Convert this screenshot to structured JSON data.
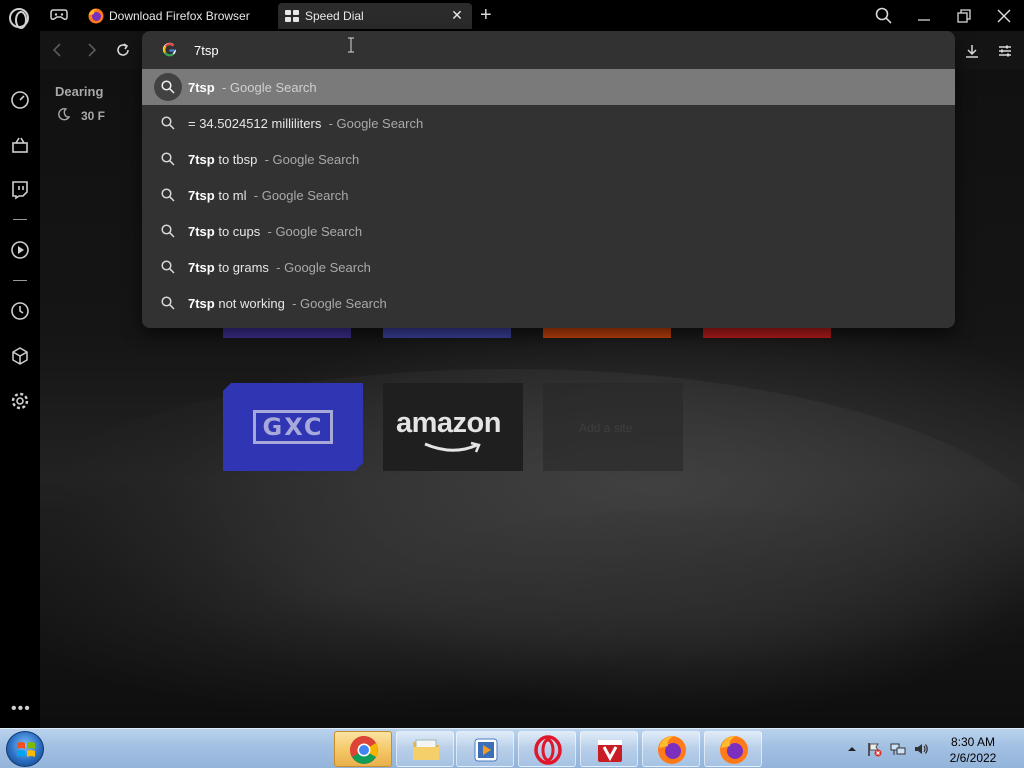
{
  "window": {
    "tabs": [
      {
        "title": "Download Firefox Browser",
        "icon": "firefox-icon"
      },
      {
        "title": "Speed Dial",
        "icon": "speed-dial-grid-icon",
        "active": true
      }
    ],
    "new_tab_symbol": "+",
    "close_symbol": "✕"
  },
  "sidebar": {
    "items": [
      "speedometer-icon",
      "shopping-bag-icon",
      "twitch-icon",
      "player-icon",
      "history-icon",
      "extensions-cube-icon",
      "settings-gear-icon"
    ],
    "more": "•••"
  },
  "weather": {
    "location": "Dearing",
    "temperature": "30 F"
  },
  "address_bar": {
    "value": "7tsp",
    "search_engine": "Google"
  },
  "suggestions": [
    {
      "bold": "7tsp",
      "rest": "",
      "suffix": "- Google Search",
      "highlighted": true
    },
    {
      "bold": "",
      "rest": "= 34.5024512 milliliters",
      "suffix": "- Google Search"
    },
    {
      "bold": "7tsp",
      "rest": " to tbsp",
      "suffix": "- Google Search"
    },
    {
      "bold": "7tsp",
      "rest": " to ml",
      "suffix": "- Google Search"
    },
    {
      "bold": "7tsp",
      "rest": " to cups",
      "suffix": "- Google Search"
    },
    {
      "bold": "7tsp",
      "rest": " to grams",
      "suffix": "- Google Search"
    },
    {
      "bold": "7tsp",
      "rest": " not working",
      "suffix": "- Google Search"
    }
  ],
  "speed_dial": {
    "tiles": [
      {
        "label": "GXC",
        "color": "#2f35b3"
      },
      {
        "label": "amazon",
        "color": "#1f1f1f"
      },
      {
        "label": "Add a site",
        "color": "#282828"
      }
    ],
    "hidden_tile_edges": [
      "#3b2f8f",
      "#3a3f9c",
      "#c2410c",
      "#b91c1c"
    ]
  },
  "taskbar": {
    "apps": [
      "chrome-icon",
      "file-explorer-icon",
      "media-player-icon",
      "opera-icon",
      "vivaldi-icon",
      "firefox-icon",
      "firefox-icon"
    ],
    "time": "8:30 AM",
    "date": "2/6/2022"
  },
  "colors": {
    "accent_dark": "#000000",
    "dropdown_bg": "#323232",
    "highlight_bg": "#7a7a7a"
  }
}
